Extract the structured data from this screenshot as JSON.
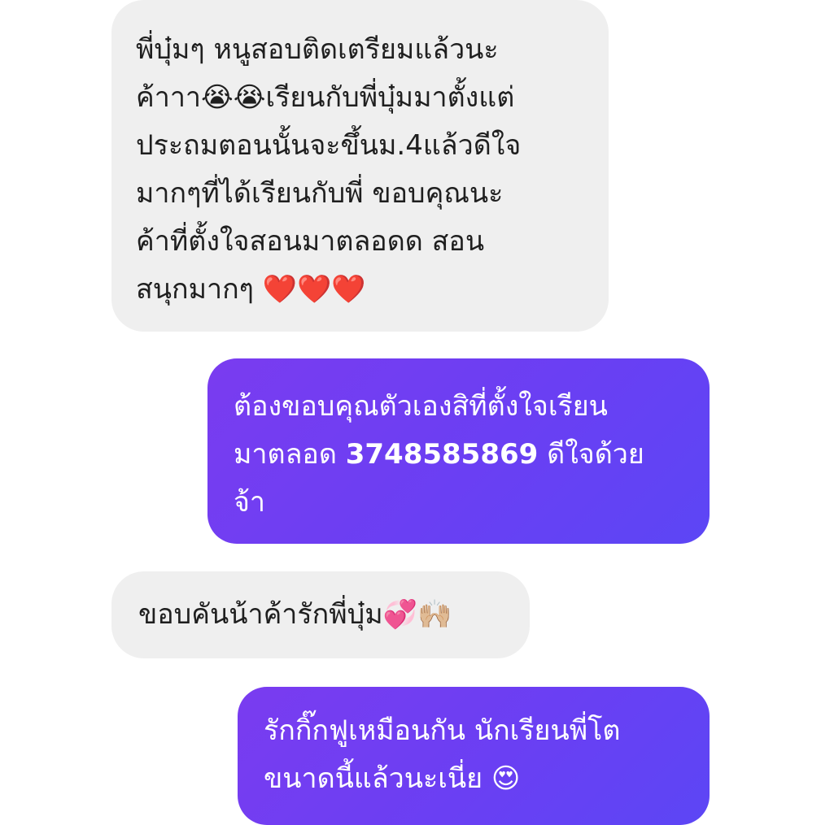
{
  "conversation": {
    "messages": [
      {
        "direction": "incoming",
        "lines": [
          "พี่บุ๋มๆ หนูสอบติดเตรียมแล้วนะ",
          "ค้าาา😭😭เรียนกับพี่บุ๋มมาตั้งแต่",
          "ประถมตอนนั้นจะขึ้นม.4แล้วดีใจ",
          "มากๆที่ได้เรียนกับพี่ ขอบคุณนะ",
          "ค้าที่ตั้งใจสอนมาตลอดด สอน",
          "สนุกมากๆ ❤️❤️❤️"
        ]
      },
      {
        "direction": "outgoing",
        "lines": [
          "ต้องขอบคุณตัวเองสิที่ตั้งใจเรียน",
          "มาตลอด",
          "3748585869",
          "ดีใจด้วย",
          "จ้า"
        ]
      },
      {
        "direction": "incoming",
        "lines": [
          "ขอบคันน้าค้ารักพี่บุ๋ม💞🙌🏼"
        ]
      },
      {
        "direction": "outgoing",
        "lines": [
          "รักกิ๊กฟูเหมือนกัน นักเรียนพี่โต",
          "ขนาดนี้แล้วนะเนี่ย 😍"
        ]
      }
    ]
  },
  "colors": {
    "incoming_bubble": "#efefef",
    "incoming_text": "#1f1f1f",
    "outgoing_bubble_start": "#7a3cf0",
    "outgoing_bubble_end": "#5c46f5",
    "outgoing_text": "#ffffff",
    "background": "#ffffff"
  }
}
